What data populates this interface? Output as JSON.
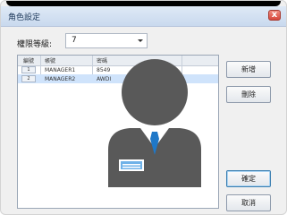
{
  "window": {
    "title": "角色設定",
    "close_label": "x"
  },
  "filter": {
    "label": "權限等級:",
    "value": "7"
  },
  "table": {
    "columns": [
      "編號",
      "帳號",
      "密碼"
    ],
    "rows": [
      {
        "num": "1",
        "account": "MANAGER1",
        "password": "8549"
      },
      {
        "num": "2",
        "account": "MANAGER2",
        "password": "AWDI"
      }
    ]
  },
  "buttons": {
    "add": "新增",
    "delete": "刪除",
    "ok": "確定",
    "cancel": "取消"
  },
  "overlay": {
    "icon": "user-avatar-icon",
    "colors": {
      "figure": "#595959",
      "shirt": "#ffffff",
      "tie": "#1f78c8",
      "badge": "#6fb2e8"
    }
  }
}
